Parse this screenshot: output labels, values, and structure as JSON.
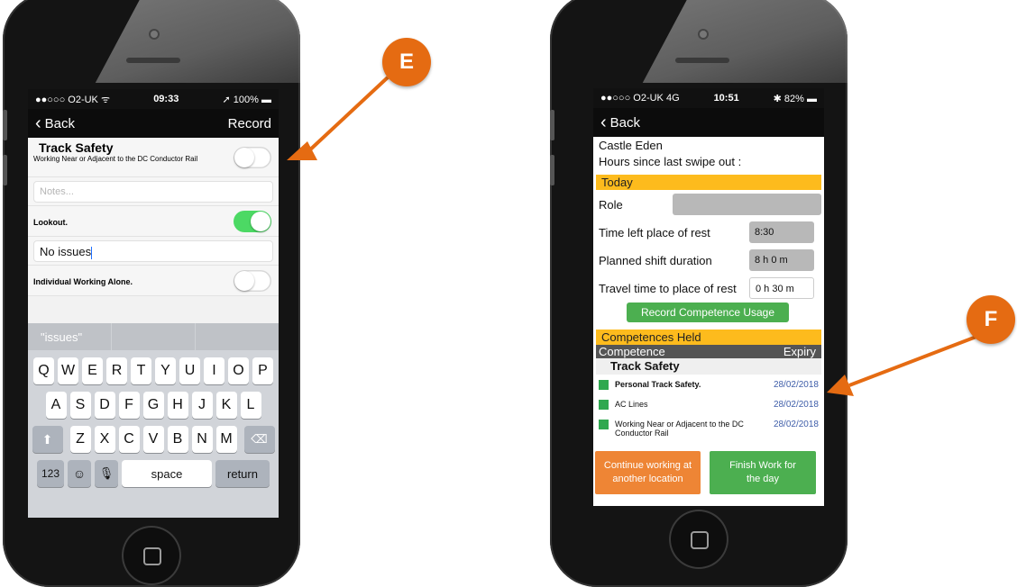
{
  "left_phone": {
    "status": {
      "carrier": "●●○○○ O2-UK ᯤ",
      "time": "09:33",
      "battery": "➚ 100% ▬"
    },
    "nav": {
      "back": "Back",
      "action": "Record"
    },
    "section_title": "Track Safety",
    "items": [
      {
        "label": "Working Near or Adjacent to the DC Conductor Rail",
        "toggle": "off"
      },
      {
        "label": "Lookout.",
        "toggle": "on"
      },
      {
        "label": "Individual Working Alone.",
        "toggle": "off"
      }
    ],
    "notes_placeholder": "Notes...",
    "lookout_value": "No issues",
    "keyboard": {
      "suggestions": [
        "\"issues\"",
        "",
        ""
      ],
      "row1": [
        "Q",
        "W",
        "E",
        "R",
        "T",
        "Y",
        "U",
        "I",
        "O",
        "P"
      ],
      "row2": [
        "A",
        "S",
        "D",
        "F",
        "G",
        "H",
        "J",
        "K",
        "L"
      ],
      "row3": [
        "Z",
        "X",
        "C",
        "V",
        "B",
        "N",
        "M"
      ],
      "num_key": "123",
      "space_key": "space",
      "return_key": "return"
    }
  },
  "right_phone": {
    "status": {
      "carrier": "●●○○○ O2-UK  4G",
      "time": "10:51",
      "battery": "✱ 82% ▬"
    },
    "nav": {
      "back": "Back"
    },
    "location": "Castle Eden",
    "hours_label": "Hours since last swipe out :",
    "today_label": "Today",
    "role_label": "Role",
    "time_left_label": "Time left place of rest",
    "time_left_value": "8:30",
    "planned_label": "Planned shift duration",
    "planned_value": "8 h  0 m",
    "travel_label": "Travel time to place of rest",
    "travel_value": "0 h 30 m",
    "record_button": "Record Competence Usage",
    "held_label": "Competences Held",
    "col_competence": "Competence",
    "col_expiry": "Expiry",
    "group_title": "Track Safety",
    "competences": [
      {
        "name": "Personal Track Safety.",
        "expiry": "28/02/2018",
        "bold": true
      },
      {
        "name": "AC Lines",
        "expiry": "28/02/2018",
        "bold": false
      },
      {
        "name": "Working Near or Adjacent to the DC Conductor Rail",
        "expiry": "28/02/2018",
        "bold": false
      }
    ],
    "continue_button": "Continue working at another location",
    "finish_button": "Finish Work for the day"
  },
  "callouts": {
    "left": "E",
    "right": "F"
  },
  "colors": {
    "accent_orange": "#e56b12",
    "toggle_on": "#4cd964",
    "yellow": "#fdbb1d",
    "green": "#4caf50"
  }
}
